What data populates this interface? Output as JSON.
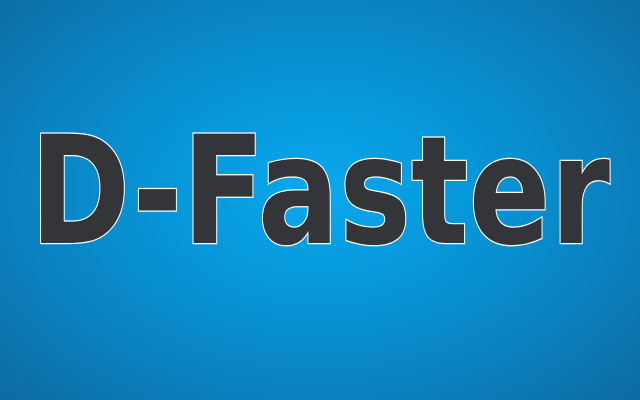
{
  "banner": {
    "title": "D-Faster",
    "colors": {
      "background_center": "#0aa8ee",
      "background_edge": "#0d6aa0",
      "text_fill": "#333538",
      "text_outline": "#ffffff"
    }
  }
}
